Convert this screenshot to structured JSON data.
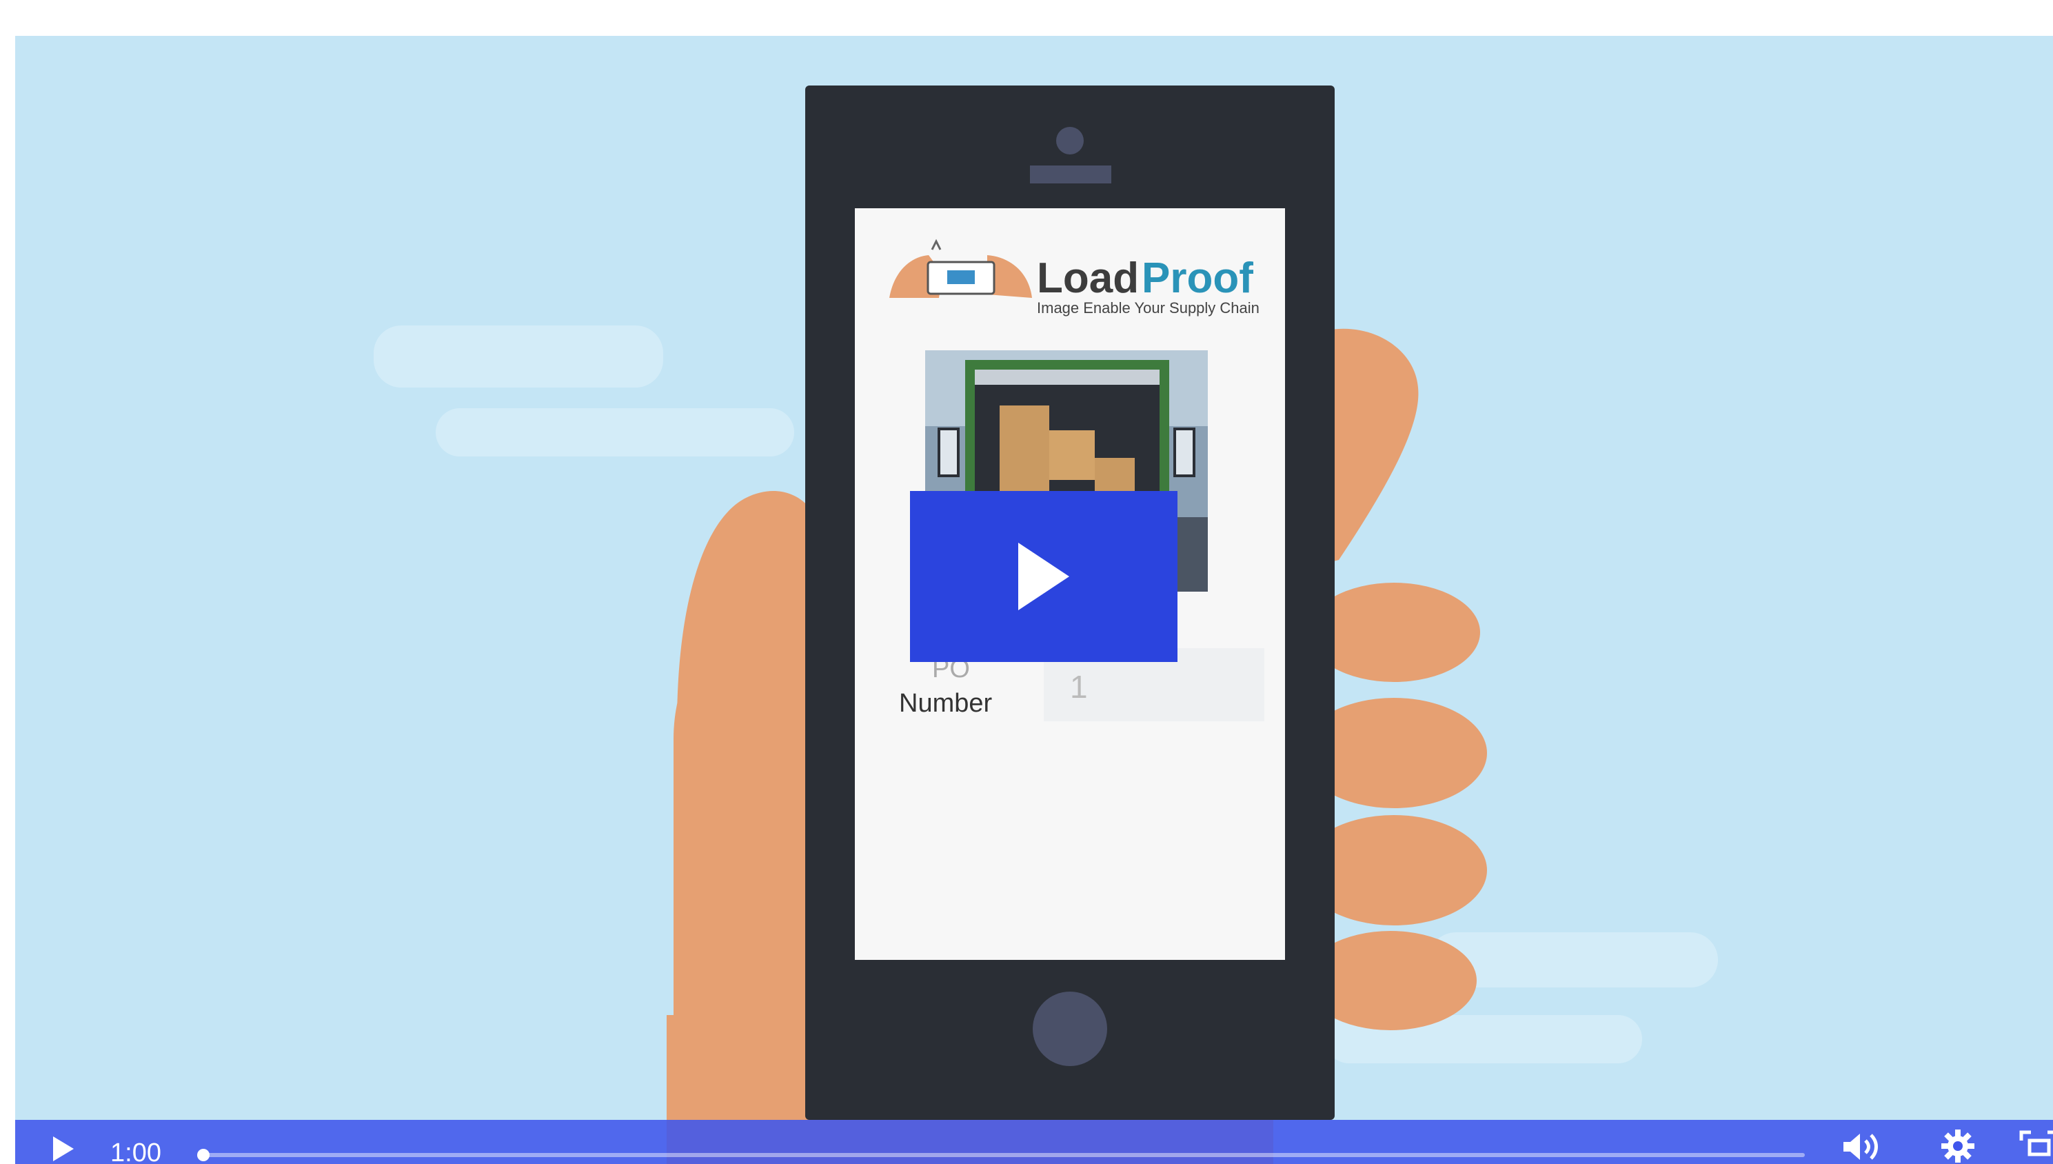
{
  "video": {
    "logo": {
      "word_load": "Load",
      "word_proof": "Proof",
      "tagline": "Image Enable Your Supply Chain"
    },
    "form": {
      "label_line1": "PO",
      "label_line2": "Number",
      "value": "1"
    },
    "player": {
      "time": "1:00",
      "progress_fraction": 0.003,
      "accent": "#2b44de",
      "bar_color": "#4056ec"
    },
    "icons": {
      "play": "play-icon",
      "volume": "volume-icon",
      "settings": "gear-icon",
      "fullscreen": "fullscreen-icon"
    }
  }
}
